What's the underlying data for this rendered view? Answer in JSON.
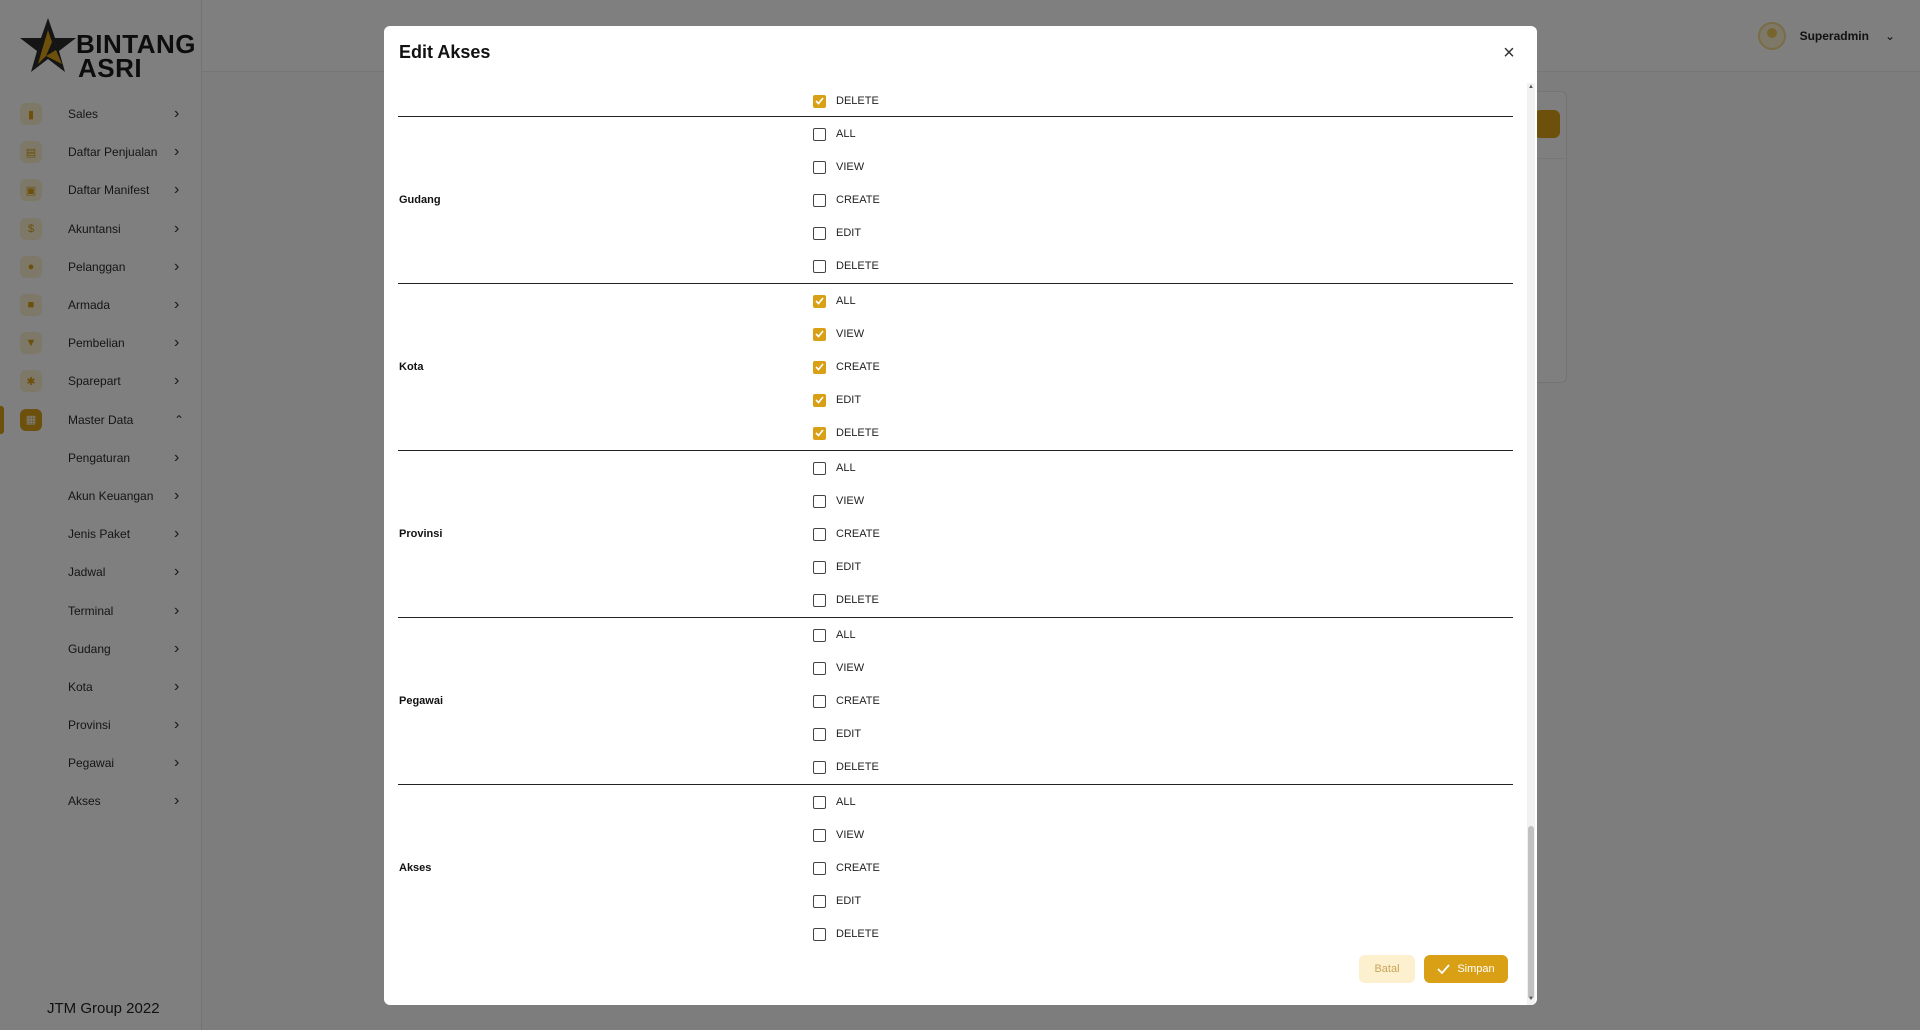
{
  "brand": {
    "line1": "BINTANG",
    "line2": "ASRI",
    "footer": "JTM Group 2022"
  },
  "header": {
    "user_name": "Superadmin"
  },
  "colors": {
    "accent": "#d9a016",
    "accent_light": "#fbf0cf",
    "overlay": "rgba(0,0,0,0.5)"
  },
  "sidebar": {
    "items": [
      {
        "label": "Sales",
        "icon": "bar-chart-icon"
      },
      {
        "label": "Daftar Penjualan",
        "icon": "receipt-icon"
      },
      {
        "label": "Daftar Manifest",
        "icon": "clipboard-icon"
      },
      {
        "label": "Akuntansi",
        "icon": "dollar-icon"
      },
      {
        "label": "Pelanggan",
        "icon": "people-icon"
      },
      {
        "label": "Armada",
        "icon": "bus-icon"
      },
      {
        "label": "Pembelian",
        "icon": "cart-icon"
      },
      {
        "label": "Sparepart",
        "icon": "puzzle-icon"
      },
      {
        "label": "Master Data",
        "icon": "database-icon",
        "expanded": true
      },
      {
        "label": "Pengaturan"
      },
      {
        "label": "Akun Keuangan"
      },
      {
        "label": "Jenis Paket"
      },
      {
        "label": "Jadwal"
      },
      {
        "label": "Terminal"
      },
      {
        "label": "Gudang"
      },
      {
        "label": "Kota"
      },
      {
        "label": "Provinsi"
      },
      {
        "label": "Pegawai"
      },
      {
        "label": "Akses"
      }
    ]
  },
  "modal": {
    "title": "Edit Akses",
    "cancel_label": "Batal",
    "save_label": "Simpan",
    "groups": [
      {
        "name": "",
        "perms": [
          {
            "label": "DELETE",
            "checked": true
          }
        ]
      },
      {
        "name": "Gudang",
        "perms": [
          {
            "label": "ALL",
            "checked": false
          },
          {
            "label": "VIEW",
            "checked": false
          },
          {
            "label": "CREATE",
            "checked": false
          },
          {
            "label": "EDIT",
            "checked": false
          },
          {
            "label": "DELETE",
            "checked": false
          }
        ]
      },
      {
        "name": "Kota",
        "perms": [
          {
            "label": "ALL",
            "checked": true
          },
          {
            "label": "VIEW",
            "checked": true
          },
          {
            "label": "CREATE",
            "checked": true
          },
          {
            "label": "EDIT",
            "checked": true
          },
          {
            "label": "DELETE",
            "checked": true
          }
        ]
      },
      {
        "name": "Provinsi",
        "perms": [
          {
            "label": "ALL",
            "checked": false
          },
          {
            "label": "VIEW",
            "checked": false
          },
          {
            "label": "CREATE",
            "checked": false
          },
          {
            "label": "EDIT",
            "checked": false
          },
          {
            "label": "DELETE",
            "checked": false
          }
        ]
      },
      {
        "name": "Pegawai",
        "perms": [
          {
            "label": "ALL",
            "checked": false
          },
          {
            "label": "VIEW",
            "checked": false
          },
          {
            "label": "CREATE",
            "checked": false
          },
          {
            "label": "EDIT",
            "checked": false
          },
          {
            "label": "DELETE",
            "checked": false
          }
        ]
      },
      {
        "name": "Akses",
        "perms": [
          {
            "label": "ALL",
            "checked": false
          },
          {
            "label": "VIEW",
            "checked": false
          },
          {
            "label": "CREATE",
            "checked": false
          },
          {
            "label": "EDIT",
            "checked": false
          },
          {
            "label": "DELETE",
            "checked": false
          }
        ]
      }
    ]
  }
}
